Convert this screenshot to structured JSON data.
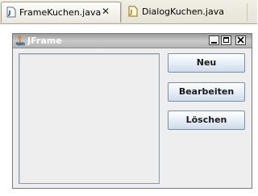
{
  "editor": {
    "tabs": [
      {
        "label": "FrameKuchen.java",
        "active": true,
        "icon": "java-file-icon",
        "closable": true
      },
      {
        "label": "DialogKuchen.java",
        "active": false,
        "icon": "java-file-icon-modified"
      }
    ]
  },
  "preview_window": {
    "title": "JFrame",
    "window_controls": [
      "minimize",
      "maximize",
      "close"
    ],
    "buttons": {
      "new": "Neu",
      "edit": "Bearbeiten",
      "delete": "Löschen"
    }
  },
  "colors": {
    "titlebar": "#a8a8a8",
    "button_border": "#7c8ea3",
    "panel_bg": "#eeeeee"
  }
}
